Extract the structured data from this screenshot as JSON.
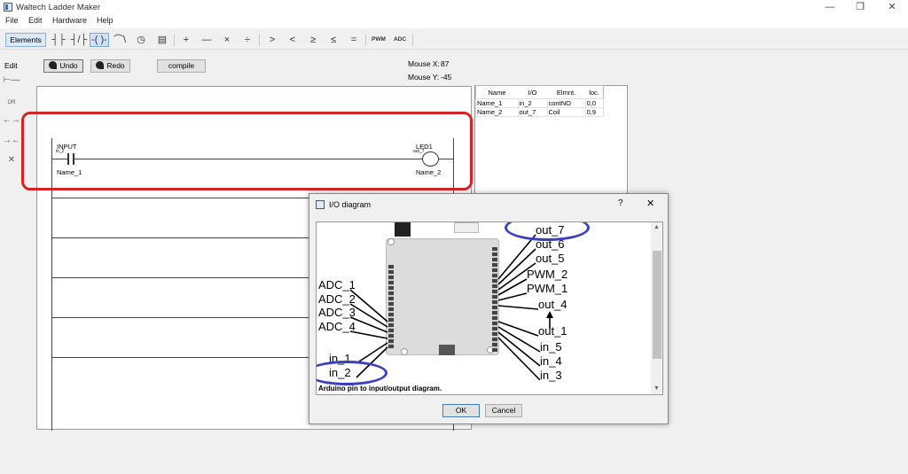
{
  "window": {
    "title": "Waltech Ladder Maker",
    "minimize_glyph": "—",
    "restore_glyph": "❐",
    "close_glyph": "✕"
  },
  "menu": [
    "File",
    "Edit",
    "Hardware",
    "Help"
  ],
  "toolbar": {
    "tab_label": "Elements",
    "tools": [
      {
        "name": "contact-no-tool",
        "glyph": "┤├"
      },
      {
        "name": "contact-nc-tool",
        "glyph": "┤/├"
      },
      {
        "name": "coil-tool",
        "glyph": "-( )-",
        "selected": true
      },
      {
        "name": "falling-edge-tool",
        "glyph": "⌒\\"
      },
      {
        "name": "timer-tool",
        "glyph": "◷"
      },
      {
        "name": "counter-tool",
        "glyph": "▤"
      },
      {
        "name": "add-tool",
        "glyph": "+"
      },
      {
        "name": "subtract-tool",
        "glyph": "—"
      },
      {
        "name": "multiply-tool",
        "glyph": "×"
      },
      {
        "name": "divide-tool",
        "glyph": "÷"
      },
      {
        "name": "greater-tool",
        "glyph": ">"
      },
      {
        "name": "less-tool",
        "glyph": "<"
      },
      {
        "name": "greater-equal-tool",
        "glyph": "≥"
      },
      {
        "name": "less-equal-tool",
        "glyph": "≤"
      },
      {
        "name": "equal-tool",
        "glyph": "="
      },
      {
        "name": "pwm-tool",
        "glyph": "PWM"
      },
      {
        "name": "adc-tool",
        "glyph": "ADC"
      }
    ]
  },
  "palette": {
    "edit_label": "Edit",
    "items": [
      "⊢—",
      "OR",
      "←→",
      "→←",
      "✕"
    ]
  },
  "actions": {
    "undo": "Undo",
    "redo": "Redo",
    "compile": "compile"
  },
  "mouse": {
    "x_label": "Mouse X:",
    "x_value": "87",
    "y_label": "Mouse Y:",
    "y_value": "-45"
  },
  "rung": {
    "contact_label": "INPUT",
    "contact_pin": "in_2",
    "contact_name": "Name_1",
    "coil_label": "LED1",
    "coil_pin": "out_7",
    "coil_name": "Name_2"
  },
  "table": {
    "headers": [
      "Name",
      "I/O",
      "Elmnt.",
      "loc."
    ],
    "rows": [
      [
        "Name_1",
        "in_2",
        "contNO",
        "0,0"
      ],
      [
        "Name_2",
        "out_7",
        "Coil",
        "0,9"
      ]
    ]
  },
  "dialog": {
    "title": "I/O diagram",
    "help": "?",
    "close": "✕",
    "caption": "Arduino pin to input/output diagram.",
    "ok": "OK",
    "cancel": "Cancel",
    "left_pins": [
      "ADC_1",
      "ADC_2",
      "ADC_3",
      "ADC_4",
      "in_1",
      "in_2"
    ],
    "right_pins": [
      "out_7",
      "out_6",
      "out_5",
      "PWM_2",
      "PWM_1",
      "out_4",
      "out_1",
      "in_5",
      "in_4",
      "in_3"
    ]
  },
  "colors": {
    "highlight": "#d22426",
    "circle_annotation": "#3a3fbf",
    "board": "#dcdcdc"
  }
}
